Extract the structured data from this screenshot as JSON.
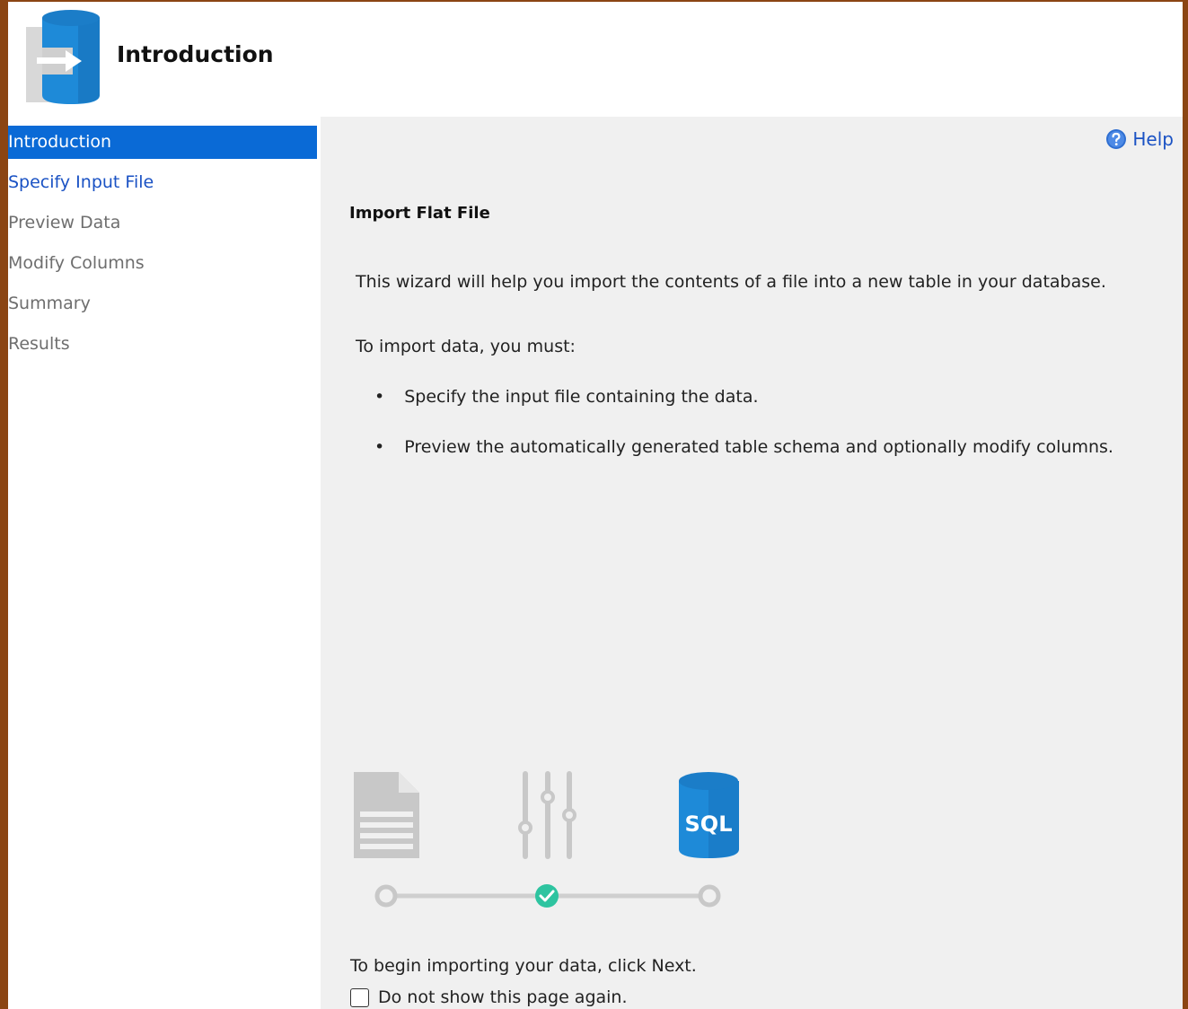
{
  "header": {
    "title": "Introduction",
    "icon": "database-import-icon"
  },
  "sidebar": {
    "items": [
      {
        "label": "Introduction",
        "state": "active"
      },
      {
        "label": "Specify Input File",
        "state": "link"
      },
      {
        "label": "Preview Data",
        "state": "disabled"
      },
      {
        "label": "Modify Columns",
        "state": "disabled"
      },
      {
        "label": "Summary",
        "state": "disabled"
      },
      {
        "label": "Results",
        "state": "disabled"
      }
    ]
  },
  "content": {
    "help_label": "Help",
    "section_title": "Import Flat File",
    "intro_text": "This wizard will help you import the contents of a file into a new table in your database.",
    "requirements_heading": "To import data, you must:",
    "bullets": [
      "Specify the input file containing the data.",
      "Preview the automatically generated table schema and optionally modify columns."
    ],
    "bullet_symbol": "•",
    "illustration": {
      "sql_label": "SQL",
      "steps": [
        "document-icon",
        "sliders-icon",
        "sql-database-icon"
      ],
      "progress_current_step": 2
    },
    "footer_text": "To begin importing your data, click Next.",
    "checkbox_label": "Do not show this page again.",
    "checkbox_checked": false
  },
  "colors": {
    "accent": "#0a6ad6",
    "link": "#1a52c4",
    "check_green": "#2ec4a0",
    "db_blue": "#1e8ad8"
  }
}
